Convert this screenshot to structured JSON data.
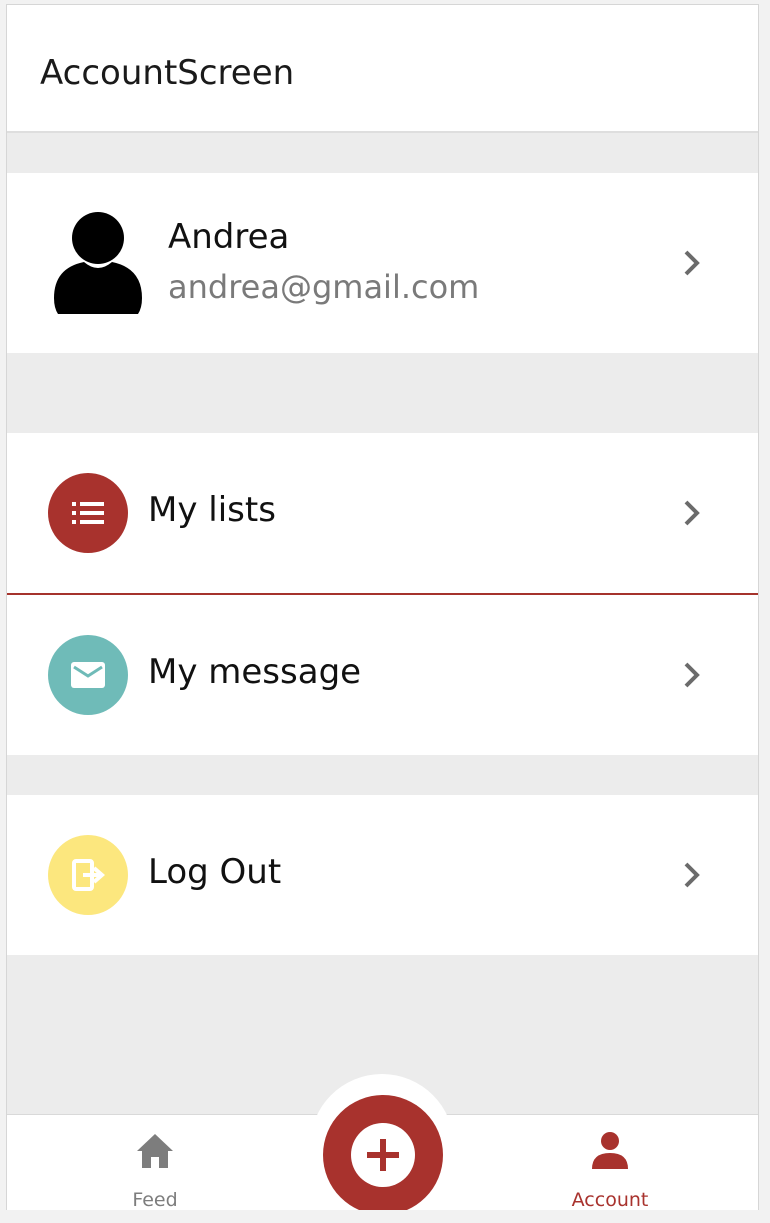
{
  "header": {
    "title": "AccountScreen"
  },
  "profile": {
    "name": "Andrea",
    "email": "andrea@gmail.com"
  },
  "menu": [
    {
      "label": "My lists",
      "icon": "list-icon",
      "color": "#a8322d"
    },
    {
      "label": "My message",
      "icon": "mail-icon",
      "color": "#6fbbb8"
    },
    {
      "label": "Log Out",
      "icon": "logout-icon",
      "color": "#fce77e"
    }
  ],
  "tabbar": {
    "feed_label": "Feed",
    "account_label": "Account",
    "active_color": "#a8322d",
    "inactive_color": "#7d7d7d"
  },
  "fab": {
    "icon": "plus-icon",
    "color": "#a8322d"
  }
}
